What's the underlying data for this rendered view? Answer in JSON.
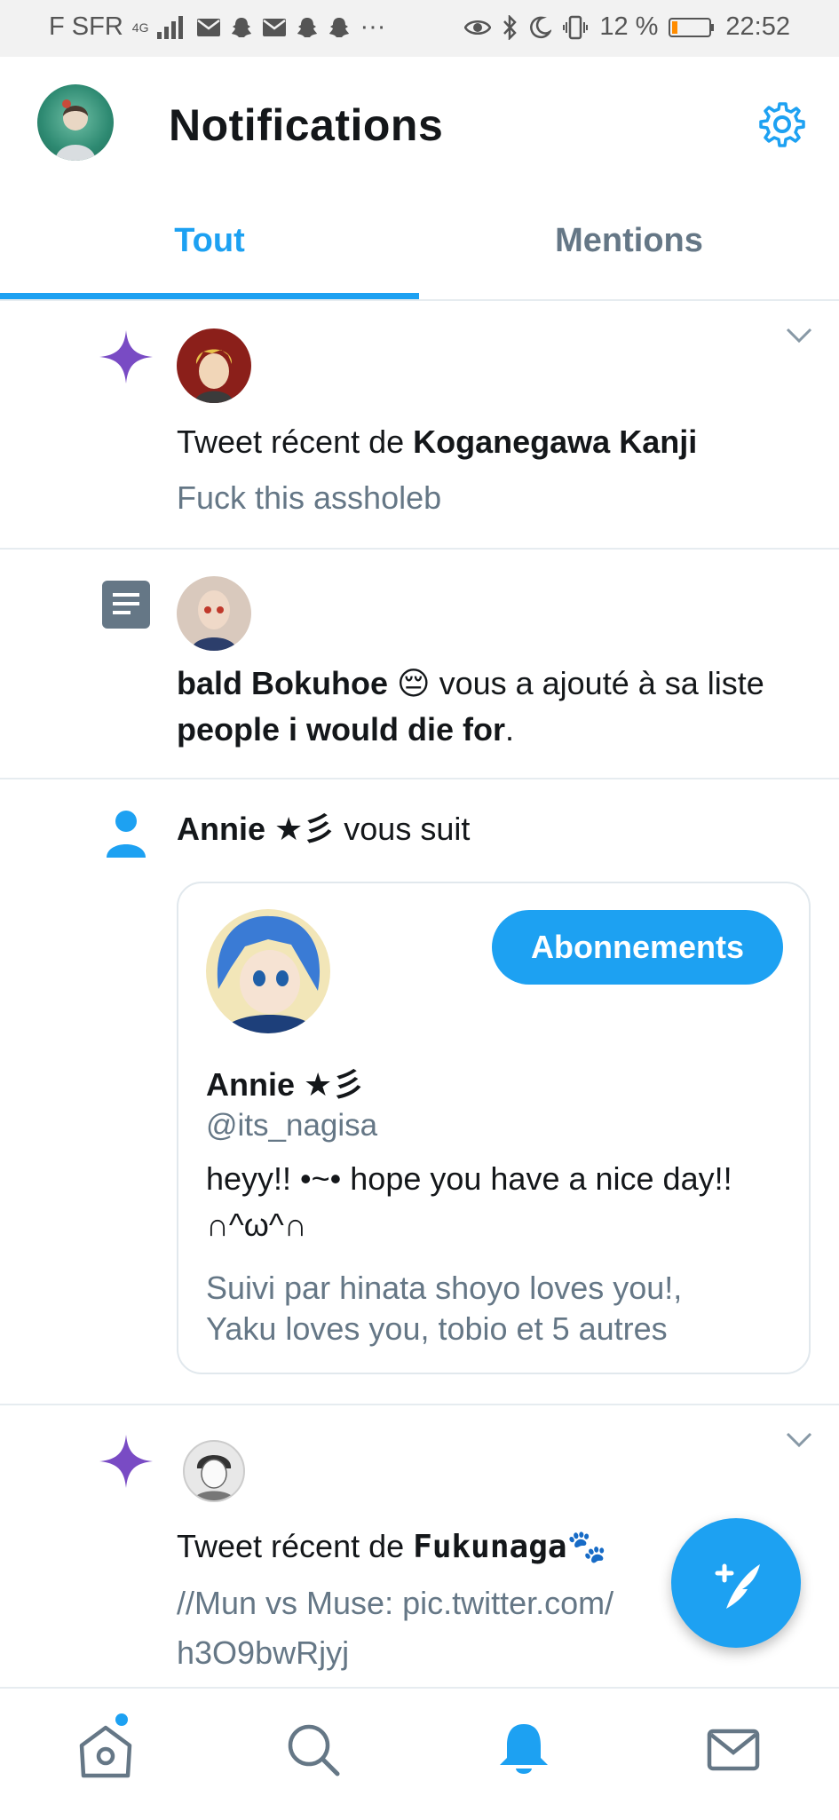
{
  "status_bar": {
    "carrier": "F SFR",
    "network": "4G",
    "battery": "12 %",
    "time": "22:52"
  },
  "header": {
    "title": "Notifications"
  },
  "tabs": [
    {
      "label": "Tout",
      "active": true
    },
    {
      "label": "Mentions",
      "active": false
    }
  ],
  "notifications": [
    {
      "type": "recent-tweet",
      "icon": "sparkle-icon",
      "prefix": "Tweet récent de ",
      "author": "Koganegawa Kanji",
      "preview": "Fuck this assholeb"
    },
    {
      "type": "list-add",
      "icon": "list-icon",
      "user": "bald Bokuhoe",
      "emoji": "😔",
      "middle": " vous a ajouté à sa liste",
      "list_name": "people i would die for",
      "suffix": "."
    },
    {
      "type": "follow",
      "icon": "person-icon",
      "user": "Annie ★彡",
      "action": " vous suit",
      "card": {
        "follow_button": "Abonnements",
        "name": "Annie ★彡",
        "handle": "@its_nagisa",
        "bio_line1": "heyy!! •~• hope you have a nice day!!",
        "bio_line2": "∩^ω^∩",
        "followed_by_line1": "Suivi par hinata shoyo loves you!,",
        "followed_by_line2": "Yaku loves you, tobio et 5 autres"
      }
    },
    {
      "type": "recent-tweet",
      "icon": "sparkle-icon",
      "prefix": "Tweet récent de ",
      "author": "Fukunaga🐾",
      "preview_line1": "//Mun vs Muse: pic.twitter.com/",
      "preview_line2": "h3O9bwRjyj"
    }
  ],
  "colors": {
    "accent": "#1da1f2",
    "sparkle": "#794bc4",
    "muted": "#657786",
    "divider": "#e6ecf0"
  },
  "bottom_nav": [
    {
      "name": "home-icon",
      "active": false,
      "badge": true
    },
    {
      "name": "search-icon",
      "active": false
    },
    {
      "name": "bell-icon",
      "active": true
    },
    {
      "name": "mail-icon",
      "active": false
    }
  ]
}
